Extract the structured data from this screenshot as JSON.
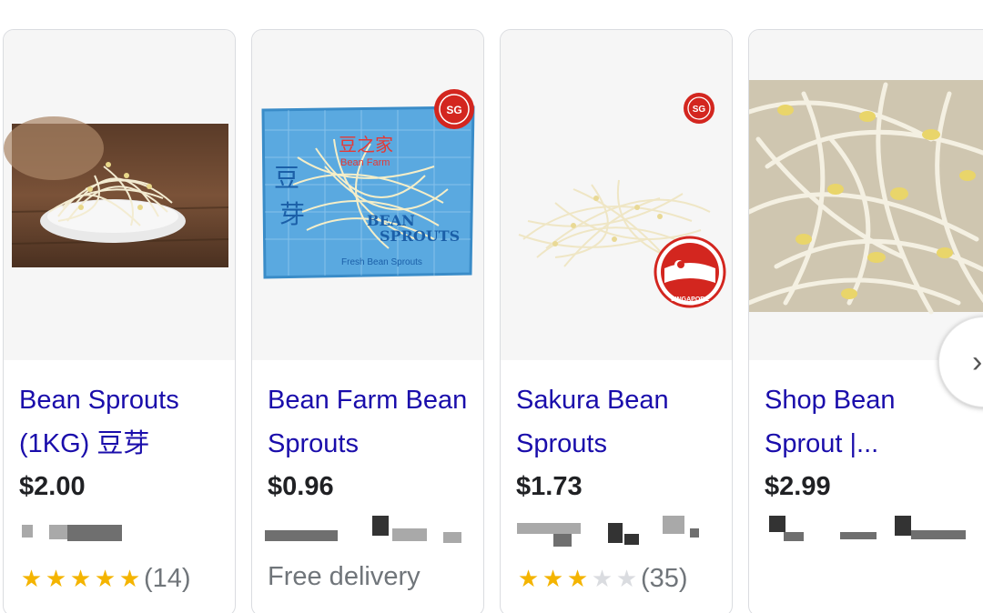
{
  "colors": {
    "link": "#1a0dab",
    "price": "#202124",
    "muted": "#70757a",
    "star": "#f4b400"
  },
  "carousel": {
    "next_icon": "chevron-right-icon",
    "next_glyph": "›"
  },
  "products": [
    {
      "title": "Bean Sprouts (1KG) 豆芽",
      "price": "$2.00",
      "rating": 5,
      "rating_count": "(14)"
    },
    {
      "title": "Bean Farm Bean Sprouts",
      "price": "$0.96",
      "delivery": "Free delivery",
      "package": {
        "brand_cn": "豆之家",
        "brand_en": "Bean Farm",
        "side_cn_1": "豆",
        "side_cn_2": "芽",
        "label_1": "BEAN",
        "label_2": "SPROUTS",
        "bottom": "Fresh Bean Sprouts",
        "badge": "SG"
      }
    },
    {
      "title": "Sakura Bean Sprouts",
      "price": "$1.73",
      "rating": 3,
      "rating_count": "(35)",
      "badge": "SG",
      "flag_label": "SINGAPORE"
    },
    {
      "title": "Shop Bean Sprout |...",
      "price": "$2.99"
    }
  ]
}
